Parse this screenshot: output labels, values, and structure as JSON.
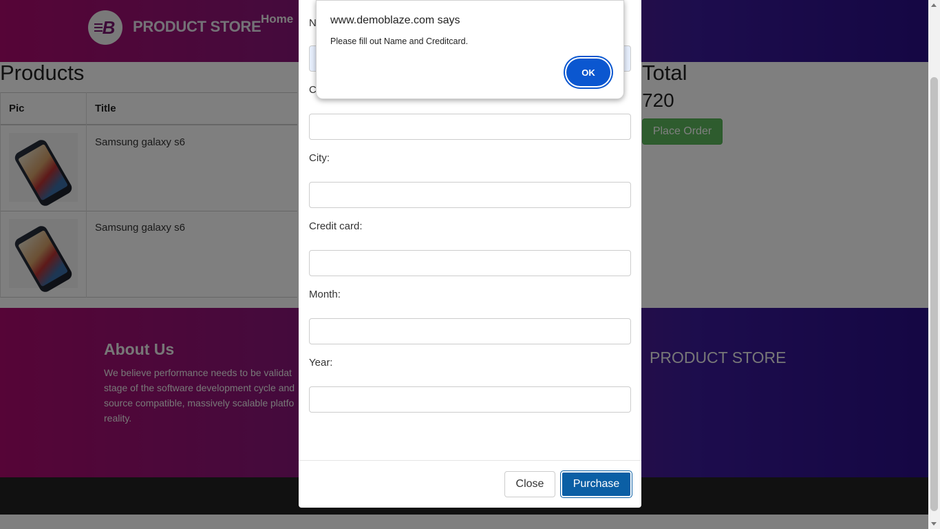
{
  "navbar": {
    "brand": "PRODUCT STORE",
    "home_link": "Home",
    "logo_letter": "B"
  },
  "products": {
    "heading": "Products",
    "columns": [
      "Pic",
      "Title"
    ],
    "rows": [
      {
        "title": "Samsung galaxy s6",
        "image": "phone-image"
      },
      {
        "title": "Samsung galaxy s6",
        "image": "phone-image"
      }
    ]
  },
  "total": {
    "label": "Total",
    "value": "720",
    "place_order_label": "Place Order"
  },
  "footer": {
    "about_title": "About Us",
    "about_text": "We believe performance needs to be validat stage of the software development cycle and source compatible, massively scalable platfo reality.",
    "brand": "PRODUCT STORE"
  },
  "modal": {
    "fields": [
      {
        "label": "City:"
      },
      {
        "label": "Credit card:"
      },
      {
        "label": "Month:"
      },
      {
        "label": "Year:"
      }
    ],
    "partial_label": "C",
    "partial_label_top": "N",
    "close_label": "Close",
    "purchase_label": "Purchase"
  },
  "alert": {
    "title": "www.demoblaze.com says",
    "message": "Please fill out Name and Creditcard.",
    "ok_label": "OK"
  },
  "colors": {
    "accent_green": "#5cb85c",
    "accent_blue": "#0b5fa5",
    "alert_blue": "#0b57d0"
  }
}
